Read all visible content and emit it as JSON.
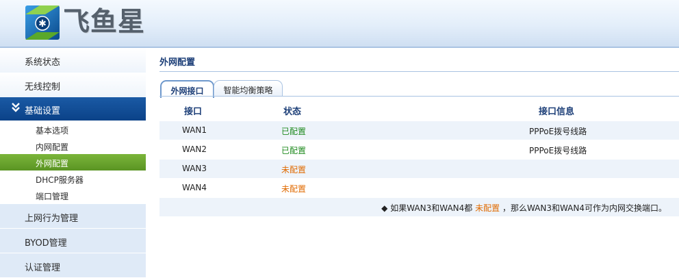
{
  "header": {
    "brand_name": "飞鱼星",
    "logo_icon": "fish-star-logo"
  },
  "sidebar": {
    "top_items": [
      {
        "label": "系统状态"
      },
      {
        "label": "无线控制"
      }
    ],
    "active_section": {
      "label": "基础设置",
      "icon": "double-chevron-down-icon"
    },
    "sub_items": [
      {
        "label": "基本选项"
      },
      {
        "label": "内网配置"
      },
      {
        "label": "外网配置",
        "active": true
      },
      {
        "label": "DHCP服务器"
      },
      {
        "label": "端口管理"
      }
    ],
    "bottom_items": [
      {
        "label": "上网行为管理"
      },
      {
        "label": "BYOD管理"
      },
      {
        "label": "认证管理"
      }
    ]
  },
  "main": {
    "title": "外网配置",
    "tabs": [
      {
        "label": "外网接口",
        "active": true
      },
      {
        "label": "智能均衡策略",
        "active": false
      }
    ],
    "table": {
      "headers": [
        "接口",
        "状态",
        "接口信息"
      ],
      "rows": [
        {
          "interface": "WAN1",
          "status": "已配置",
          "info": "PPPoE拨号线路"
        },
        {
          "interface": "WAN2",
          "status": "已配置",
          "info": "PPPoE拨号线路"
        },
        {
          "interface": "WAN3",
          "status": "未配置",
          "info": ""
        },
        {
          "interface": "WAN4",
          "status": "未配置",
          "info": ""
        }
      ]
    },
    "note": {
      "bullet": "◆",
      "prefix": " 如果WAN3和WAN4都 ",
      "highlight": "未配置",
      "suffix": " ，那么WAN3和WAN4可作为内网交换端口。"
    }
  },
  "colors": {
    "primary_blue": "#0b4288",
    "active_green": "#5a9423",
    "configured": "#1e8a1e",
    "unconfigured": "#e06a00",
    "row_stripe": "#edf3fa"
  }
}
